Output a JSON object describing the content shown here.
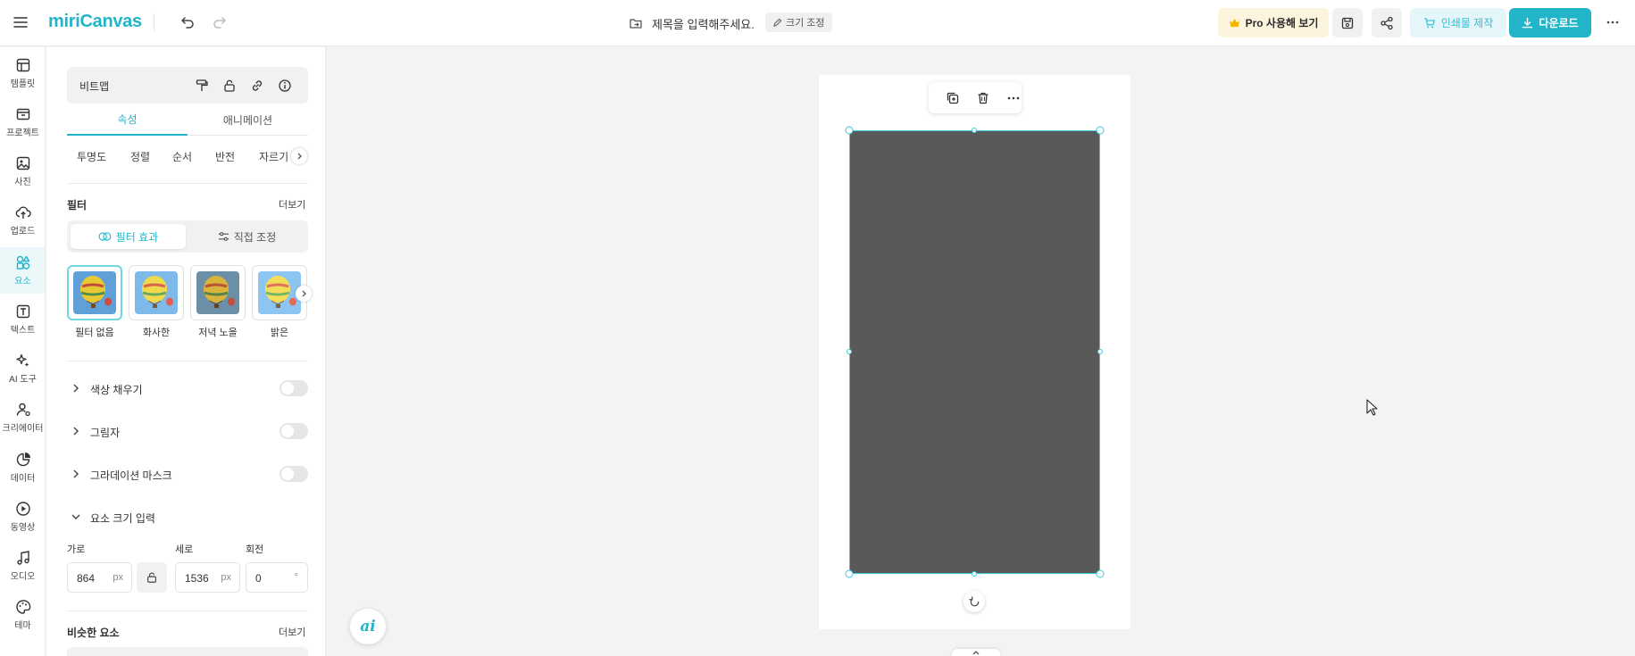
{
  "app": {
    "logo": "miriCanvas"
  },
  "header": {
    "doc_title": "제목을 입력해주세요.",
    "resize_label": "크기 조정",
    "pro_label": "Pro 사용해 보기",
    "print_label": "인쇄물 제작",
    "download_label": "다운로드",
    "accent_color": "#22b5c9"
  },
  "rail": {
    "items": [
      {
        "label": "템플릿",
        "icon": "layout-icon"
      },
      {
        "label": "프로젝트",
        "icon": "folder-icon"
      },
      {
        "label": "사진",
        "icon": "image-icon"
      },
      {
        "label": "업로드",
        "icon": "upload-icon"
      },
      {
        "label": "요소",
        "icon": "shapes-icon",
        "active": true
      },
      {
        "label": "텍스트",
        "icon": "text-icon"
      },
      {
        "label": "AI 도구",
        "icon": "sparkle-icon"
      },
      {
        "label": "크리에이터",
        "icon": "creator-icon"
      },
      {
        "label": "데이터",
        "icon": "chart-icon"
      },
      {
        "label": "동영상",
        "icon": "video-icon"
      },
      {
        "label": "오디오",
        "icon": "music-icon"
      },
      {
        "label": "테마",
        "icon": "palette-icon"
      }
    ]
  },
  "panel": {
    "object_name": "비트맵",
    "tabs": [
      "속성",
      "애니메이션"
    ],
    "subtabs": [
      "투명도",
      "정렬",
      "순서",
      "반전",
      "자르기"
    ],
    "filter": {
      "title": "필터",
      "more": "더보기",
      "seg_effect": "필터 효과",
      "seg_adjust": "직접 조정",
      "presets": [
        "필터 없음",
        "화사한",
        "저녁 노을",
        "밝은"
      ]
    },
    "toggles": [
      {
        "label": "색상 채우기",
        "on": false
      },
      {
        "label": "그림자",
        "on": false
      },
      {
        "label": "그라데이션 마스크",
        "on": false
      }
    ],
    "size": {
      "title": "요소 크기 입력",
      "width_label": "가로",
      "height_label": "세로",
      "rotate_label": "회전",
      "width": "864",
      "height": "1536",
      "rotation": "0",
      "unit_px": "px",
      "unit_deg": "°"
    },
    "similar": {
      "title": "비슷한 요소",
      "more": "더보기"
    }
  },
  "canvas": {
    "element_color": "#595959",
    "ai_label": "ai"
  }
}
